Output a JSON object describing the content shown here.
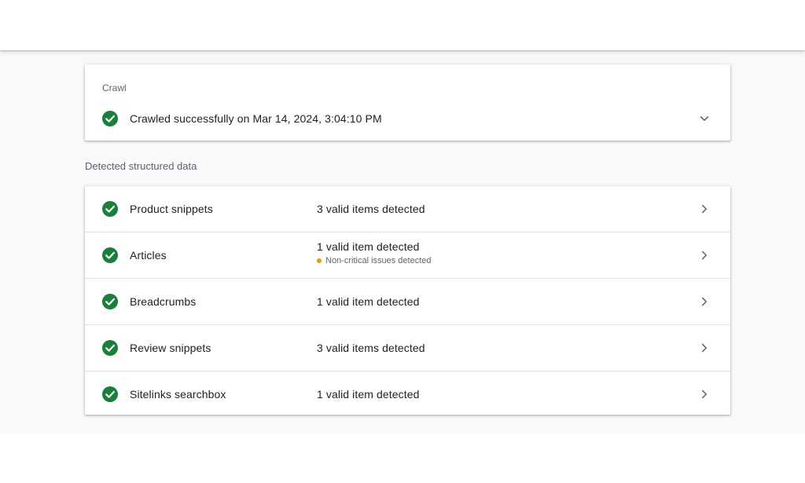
{
  "colors": {
    "check_green": "#188038",
    "warning_orange": "#f29900",
    "chevron_gray": "#5f6368"
  },
  "icons": {
    "status": "check-circle-icon",
    "expand": "chevron-down-icon",
    "navigate": "chevron-right-icon"
  },
  "crawl": {
    "label": "Crawl",
    "status_text": "Crawled successfully on Mar 14, 2024, 3:04:10 PM"
  },
  "structured_data": {
    "title": "Detected structured data",
    "items": [
      {
        "name": "Product snippets",
        "status": "3 valid items detected",
        "note": ""
      },
      {
        "name": "Articles",
        "status": "1 valid item detected",
        "note": "Non-critical issues detected"
      },
      {
        "name": "Breadcrumbs",
        "status": "1 valid item detected",
        "note": ""
      },
      {
        "name": "Review snippets",
        "status": "3 valid items detected",
        "note": ""
      },
      {
        "name": "Sitelinks searchbox",
        "status": "1 valid item detected",
        "note": ""
      }
    ]
  }
}
